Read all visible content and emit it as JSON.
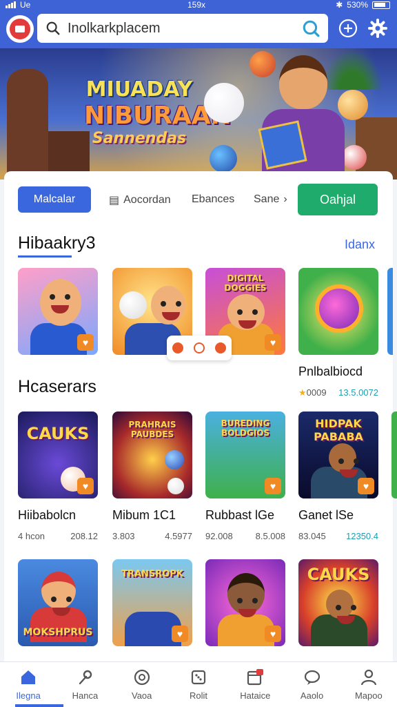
{
  "status_bar": {
    "carrier": "Ue",
    "time": "159x",
    "battery": "530%"
  },
  "header": {
    "search_text": "Inolkarkplacem"
  },
  "banner": {
    "line1": "MIUADAY",
    "line2": "NIBURAAN",
    "line3": "Sannendas"
  },
  "tabs": [
    {
      "label": "Malcalar",
      "active": true
    },
    {
      "label": "Aocordan"
    },
    {
      "label": "Ebances"
    },
    {
      "label": "Sane"
    },
    {
      "label": "Oahjal",
      "cta": true
    }
  ],
  "section1": {
    "title": "Hibaakry3",
    "see_all": "Idanx",
    "games": [
      {
        "name": "",
        "logo": ""
      },
      {
        "name": "",
        "logo": ""
      },
      {
        "name": "",
        "logo": "DIGITAL DOGGIES"
      },
      {
        "name": "Pnlbalbiocd",
        "logo": "",
        "stat_left": "0009",
        "stat_right": "13.5.0072"
      }
    ],
    "card4_rating": "4"
  },
  "section2": {
    "title": "Hcaserars",
    "games": [
      {
        "name": "Hiibabolcn",
        "logo": "CAUKS",
        "stat_left": "4 hcon",
        "stat_right": "208.12"
      },
      {
        "name": "Mibum 1C1",
        "logo": "PRAHRAIS PAUBDES",
        "stat_left": "3.803",
        "stat_right": "4.5977"
      },
      {
        "name": "Rubbast lGe",
        "logo": "BUREDING BOLDGIOS",
        "stat_left": "92.008",
        "stat_right": "8.5.008"
      },
      {
        "name": "Ganet lSe",
        "logo": "HIDPAK PABABA",
        "stat_left": "83.045",
        "stat_right": "12350.4"
      }
    ]
  },
  "section3": {
    "games": [
      {
        "logo": "MOKSHPRUS"
      },
      {
        "logo": "TRANSROPK"
      },
      {
        "logo": ""
      },
      {
        "logo": "CAUKS"
      }
    ]
  },
  "bottom_nav": [
    {
      "label": "Ilegna",
      "icon": "home-icon",
      "active": true
    },
    {
      "label": "Hanca",
      "icon": "wrench-icon"
    },
    {
      "label": "Vaoa",
      "icon": "compass-icon"
    },
    {
      "label": "Rolit",
      "icon": "dice-icon"
    },
    {
      "label": "Hataice",
      "icon": "calendar-icon",
      "badge": "1"
    },
    {
      "label": "Aaolo",
      "icon": "chat-icon"
    },
    {
      "label": "Mapoo",
      "icon": "profile-icon"
    }
  ],
  "colors": {
    "primary": "#3d63d6",
    "green": "#1eab6b",
    "accent": "#3b67de",
    "orange": "#f08a24"
  }
}
